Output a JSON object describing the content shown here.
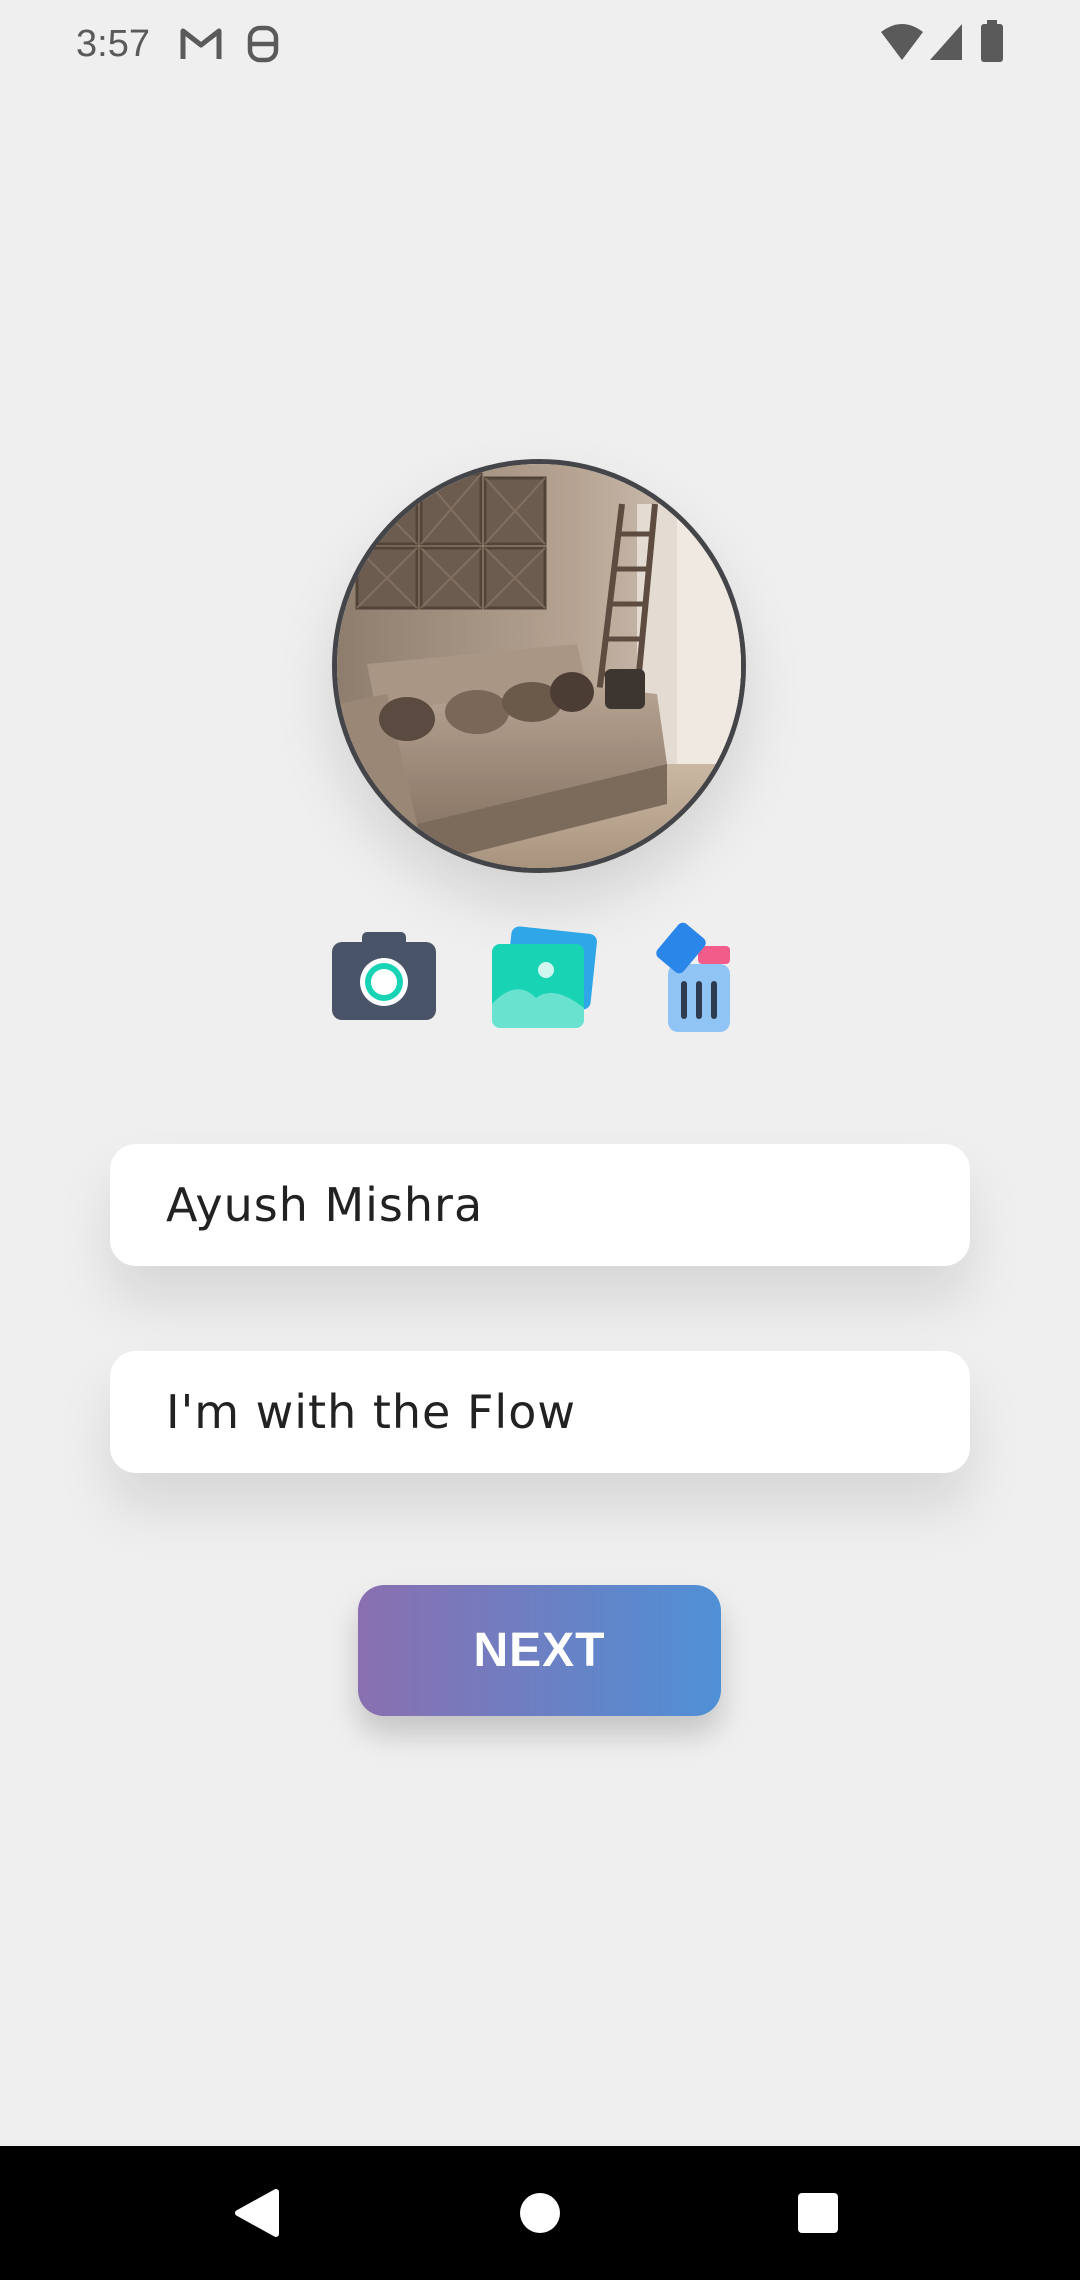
{
  "status_bar": {
    "time": "3:57",
    "left_icons": [
      "gmail-icon",
      "notification-app-icon"
    ],
    "right_icons": [
      "wifi-icon",
      "cellular-signal-icon",
      "battery-icon"
    ]
  },
  "profile": {
    "avatar_icon": "profile-photo",
    "actions": [
      {
        "name": "camera-icon",
        "label": "camera"
      },
      {
        "name": "gallery-icon",
        "label": "gallery"
      },
      {
        "name": "trash-icon",
        "label": "delete"
      }
    ]
  },
  "form": {
    "name_value": "Ayush Mishra",
    "status_value": "I'm with the Flow"
  },
  "next_label": "NEXT",
  "nav": {
    "icons": [
      "back-icon",
      "home-icon",
      "recents-icon"
    ]
  },
  "colors": {
    "background": "#efefef",
    "button_gradient_start": "#8a6fb0",
    "button_gradient_end": "#4f90d6",
    "camera_body": "#4a5468",
    "gallery_teal": "#19d3b5",
    "trash_blue": "#8fc4f5"
  }
}
